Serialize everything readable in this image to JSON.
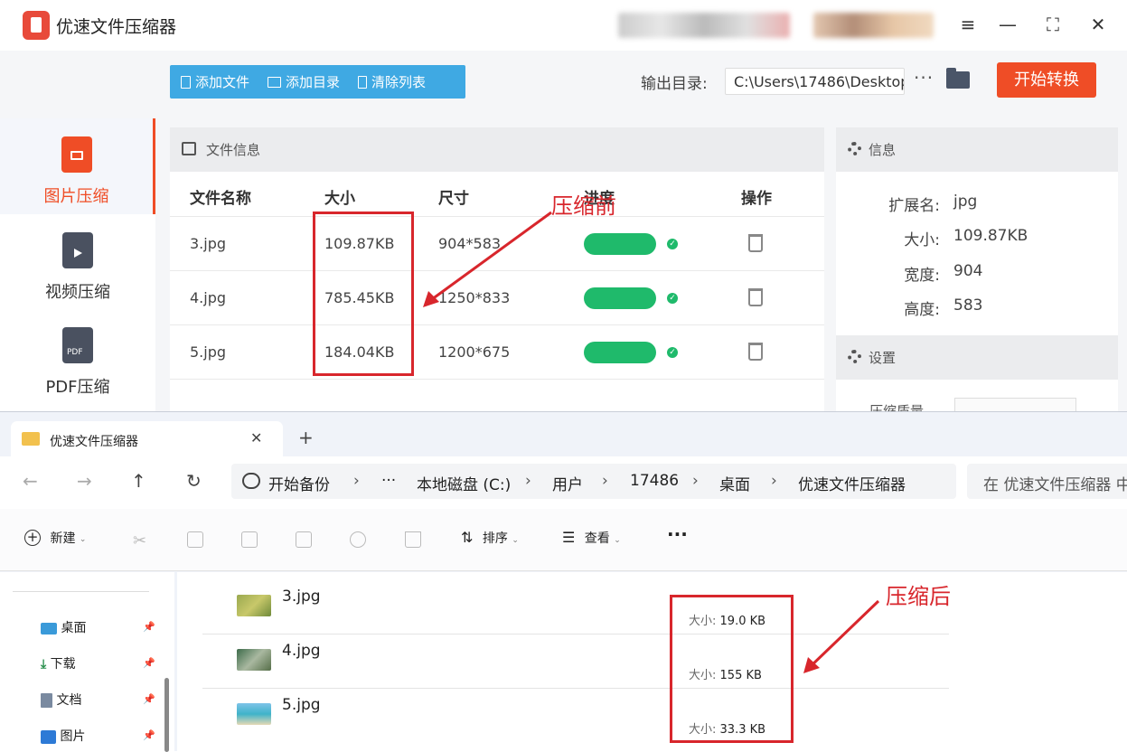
{
  "app": {
    "title": "优速文件压缩器",
    "toolbar": {
      "add_file": "添加文件",
      "add_dir": "添加目录",
      "clear_list": "清除列表"
    },
    "output_label": "输出目录:",
    "output_path": "C:\\Users\\17486\\Desktop",
    "more": "···",
    "start_button": "开始转换",
    "sidebar": [
      {
        "label": "图片压缩",
        "icon": "image-file-icon",
        "active": true
      },
      {
        "label": "视频压缩",
        "icon": "video-file-icon",
        "active": false
      },
      {
        "label": "PDF压缩",
        "icon": "pdf-file-icon",
        "active": false
      }
    ],
    "file_panel": {
      "title": "文件信息",
      "headers": {
        "name": "文件名称",
        "size": "大小",
        "dimensions": "尺寸",
        "progress": "进度",
        "actions": "操作"
      },
      "rows": [
        {
          "name": "3.jpg",
          "size": "109.87KB",
          "dimensions": "904*583",
          "progress": 1.0
        },
        {
          "name": "4.jpg",
          "size": "785.45KB",
          "dimensions": "1250*833",
          "progress": 1.0
        },
        {
          "name": "5.jpg",
          "size": "184.04KB",
          "dimensions": "1200*675",
          "progress": 1.0
        }
      ]
    },
    "info_panel": {
      "title": "信息",
      "ext_label": "扩展名:",
      "ext": "jpg",
      "size_label": "大小:",
      "size": "109.87KB",
      "width_label": "宽度:",
      "width": "904",
      "height_label": "高度:",
      "height": "583"
    },
    "settings": {
      "title": "设置",
      "quality_label": "压缩质量"
    }
  },
  "annotations": {
    "before": "压缩前",
    "after": "压缩后"
  },
  "explorer": {
    "tab_title": "优速文件压缩器",
    "new_tab": "+",
    "breadcrumb": [
      "开始备份",
      "···",
      "本地磁盘 (C:)",
      "用户",
      "17486",
      "桌面",
      "优速文件压缩器"
    ],
    "search_placeholder": "在 优速文件压缩器 中",
    "commands": {
      "new": "新建",
      "sort": "排序",
      "view": "查看",
      "more": "···"
    },
    "nav": [
      {
        "label": "桌面",
        "icon": "desktop-icon"
      },
      {
        "label": "下载",
        "icon": "download-icon"
      },
      {
        "label": "文档",
        "icon": "document-icon"
      },
      {
        "label": "图片",
        "icon": "pictures-icon"
      }
    ],
    "files": [
      {
        "name": "3.jpg",
        "size_label": "大小:",
        "size": "19.0 KB"
      },
      {
        "name": "4.jpg",
        "size_label": "大小:",
        "size": "155 KB"
      },
      {
        "name": "5.jpg",
        "size_label": "大小:",
        "size": "33.3 KB"
      }
    ]
  },
  "colors": {
    "accent": "#ef4d26",
    "toolbar": "#3fa9e3",
    "progress": "#1fba6b",
    "annotation": "#d8262c"
  }
}
